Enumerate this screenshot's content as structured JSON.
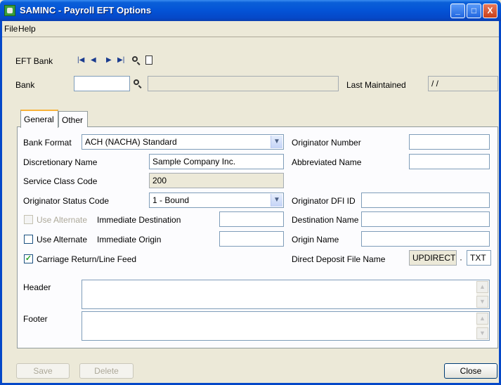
{
  "window": {
    "title": "SAMINC - Payroll EFT Options",
    "min": "_",
    "max": "□",
    "close": "X"
  },
  "menu": {
    "file": "File",
    "help": "Help"
  },
  "eft_bank_label": "EFT Bank",
  "bank": {
    "label": "Bank",
    "value": "",
    "description": "",
    "last_maintained_label": "Last Maintained",
    "last_maintained_value": "/ /"
  },
  "tabs": {
    "general": "General",
    "other": "Other"
  },
  "general": {
    "bank_format_label": "Bank Format",
    "bank_format_value": "ACH (NACHA) Standard",
    "discretionary_name_label": "Discretionary Name",
    "discretionary_name_value": "Sample Company Inc.",
    "service_class_code_label": "Service Class Code",
    "service_class_code_value": "200",
    "originator_status_code_label": "Originator Status Code",
    "originator_status_code_value": "1 - Bound",
    "use_alternate_label_1": "Use Alternate",
    "immediate_destination_label": "Immediate Destination",
    "immediate_destination_value": "",
    "use_alternate_label_2": "Use Alternate",
    "immediate_origin_label": "Immediate Origin",
    "immediate_origin_value": "",
    "carriage_return_label": "Carriage Return/Line Feed",
    "carriage_return_checked": true,
    "originator_number_label": "Originator Number",
    "originator_number_value": "",
    "abbreviated_name_label": "Abbreviated Name",
    "abbreviated_name_value": "",
    "originator_dfi_id_label": "Originator DFI ID",
    "originator_dfi_id_value": "",
    "destination_name_label": "Destination Name",
    "destination_name_value": "",
    "origin_name_label": "Origin Name",
    "origin_name_value": "",
    "direct_deposit_file_name_label": "Direct Deposit File Name",
    "direct_deposit_file_name_value": "UPDIRECT",
    "direct_deposit_separator": "·",
    "direct_deposit_file_ext": "TXT",
    "header_label": "Header",
    "footer_label": "Footer"
  },
  "buttons": {
    "save": "Save",
    "delete": "Delete",
    "close": "Close"
  }
}
